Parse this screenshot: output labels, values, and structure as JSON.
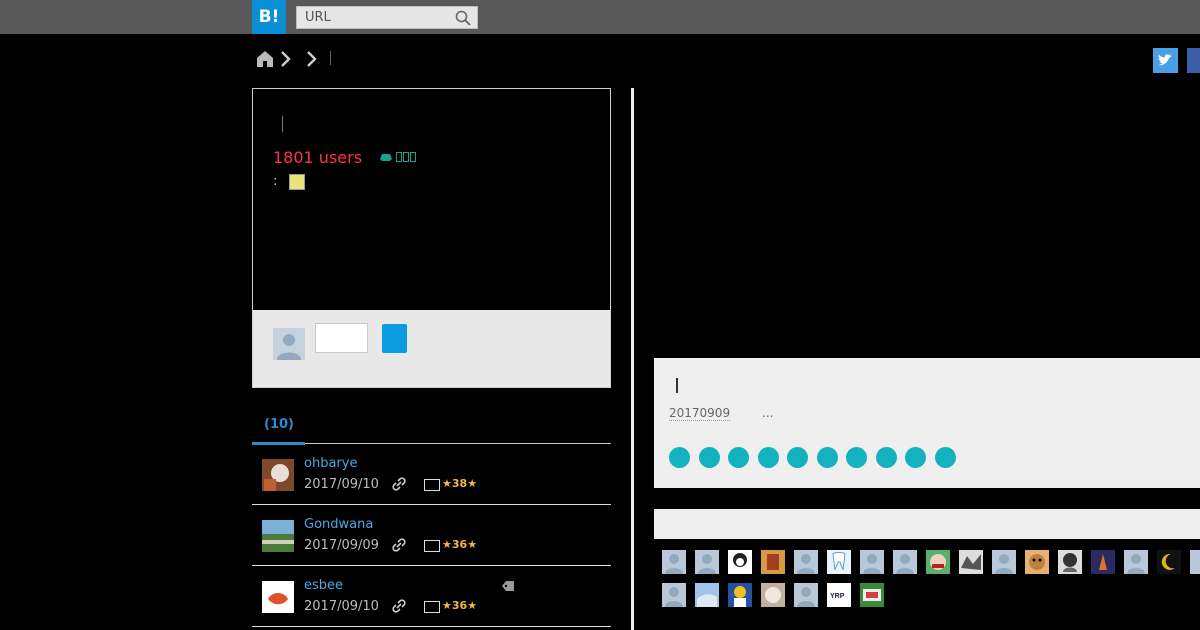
{
  "header": {
    "logo_text": "B!",
    "search_placeholder": "URL"
  },
  "breadcrumb": {
    "items": [
      "home",
      "level-1",
      "level-2"
    ]
  },
  "entry_card": {
    "users_count": "1801 users",
    "colon": ":"
  },
  "tabs": {
    "active_label": "(10)"
  },
  "bookmarks": [
    {
      "user": "ohbarye",
      "date": "2017/09/10",
      "stars": "38",
      "has_tag": false
    },
    {
      "user": "Gondwana",
      "date": "2017/09/09",
      "stars": "36",
      "has_tag": false
    },
    {
      "user": "esbee",
      "date": "2017/09/10",
      "stars": "36",
      "has_tag": true
    }
  ],
  "related_entry": {
    "date": "20170909",
    "more": "..."
  },
  "colors": {
    "accent": "#0a8fd5",
    "users": "#ff3344",
    "dots": "#13b2be",
    "stars": "#f4b54a"
  }
}
